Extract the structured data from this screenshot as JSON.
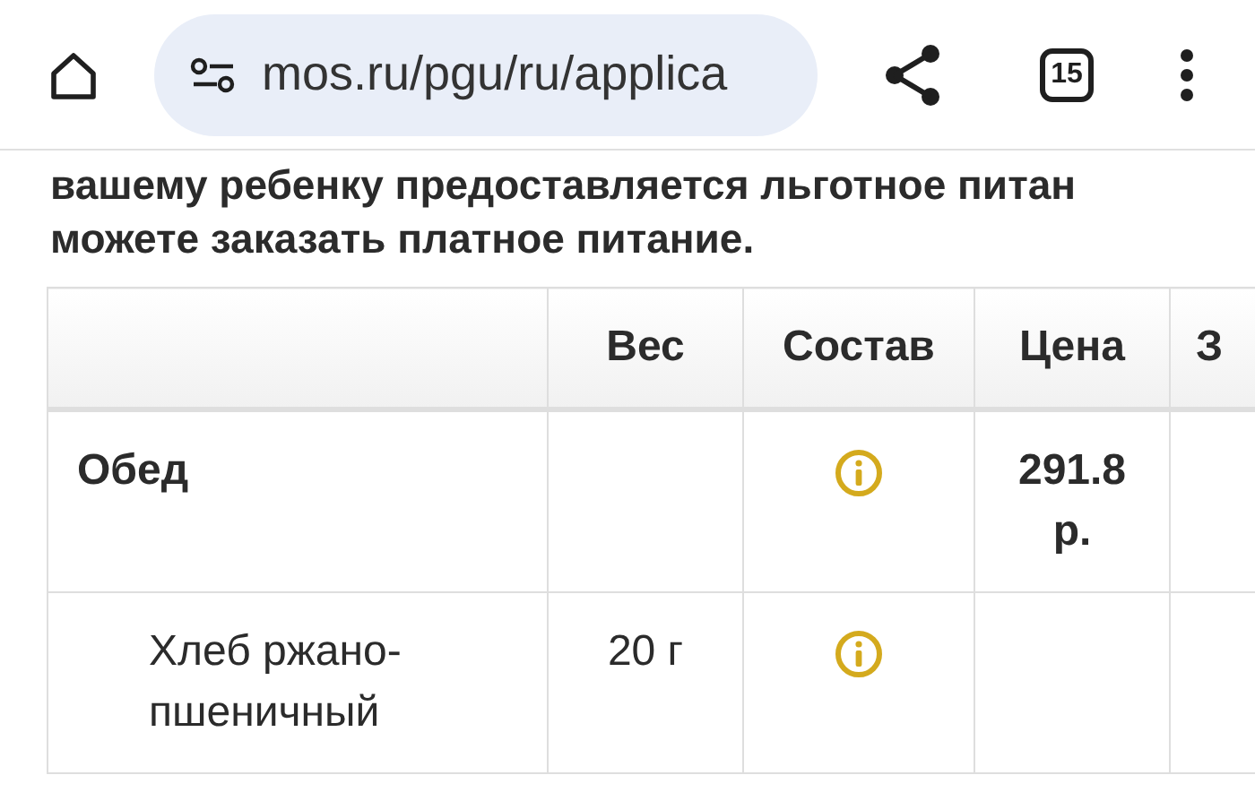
{
  "browser": {
    "url": "mos.ru/pgu/ru/applica",
    "tab_count": "15"
  },
  "intro": {
    "line_1": "вашему ребенку предоставляется льготное питан",
    "line_2": "можете заказать платное питание."
  },
  "table": {
    "columns": [
      "Вес",
      "Состав",
      "Цена",
      "З"
    ],
    "rows": [
      {
        "kind": "group",
        "name": "Обед",
        "info": true,
        "price": "291.8 р."
      },
      {
        "kind": "item",
        "name": "Хлеб ржано-пшеничный",
        "weight": "20 г",
        "info": true
      }
    ]
  }
}
